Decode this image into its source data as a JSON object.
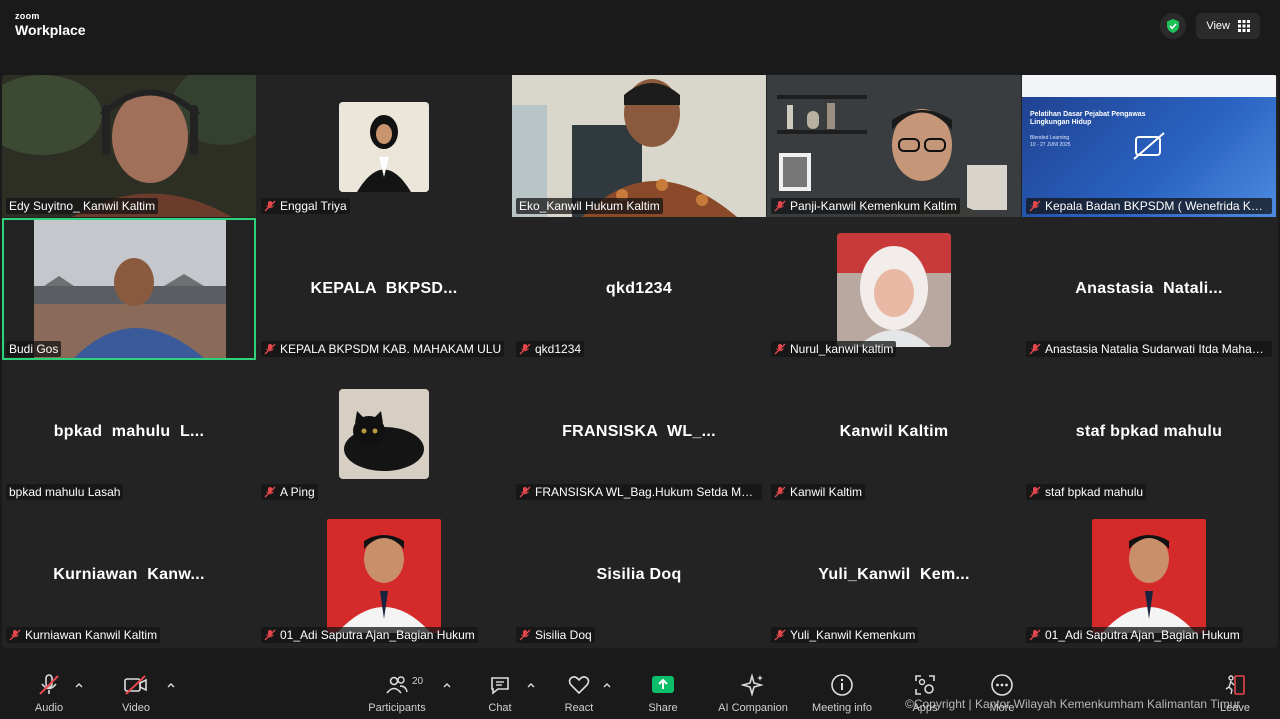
{
  "brand": {
    "small": "zoom",
    "big": "Workplace"
  },
  "topbar": {
    "view_label": "View",
    "shield_icon": "verified-shield-icon",
    "grid_icon": "grid-icon"
  },
  "tiles": [
    {
      "label": "Edy Suyitno_ Kanwil Kaltim",
      "muted": false,
      "kind": "video"
    },
    {
      "label": "Enggal Triya",
      "muted": true,
      "kind": "photo"
    },
    {
      "label": "Eko_Kanwil Hukum Kaltim",
      "muted": false,
      "kind": "video"
    },
    {
      "label": "Panji-Kanwil Kemenkum Kaltim",
      "muted": true,
      "kind": "video"
    },
    {
      "label": "Kepala Badan BKPSDM ( Wenefrida Kaya...",
      "muted": true,
      "kind": "slide",
      "slide_title": "Pelatihan Dasar Pejabat Pengawas Lingkungan Hidup",
      "slide_sub": "Blended Learning",
      "slide_date": "10 - 27 JUNI 2025"
    },
    {
      "label": "Budi Gos",
      "muted": false,
      "kind": "video",
      "active": true
    },
    {
      "label": "KEPALA BKPSDM KAB. MAHAKAM ULU",
      "muted": true,
      "kind": "name",
      "display": "KEPALA  BKPSD..."
    },
    {
      "label": "qkd1234",
      "muted": true,
      "kind": "name",
      "display": "qkd1234"
    },
    {
      "label": "Nurul_kanwil kaltim",
      "muted": true,
      "kind": "photo"
    },
    {
      "label": "Anastasia Natalia Sudarwati Itda Mahaka...",
      "muted": true,
      "kind": "name",
      "display": "Anastasia  Natali..."
    },
    {
      "label": "bpkad mahulu Lasah",
      "muted": false,
      "kind": "name",
      "display": "bpkad  mahulu  L..."
    },
    {
      "label": "A Ping",
      "muted": true,
      "kind": "photo"
    },
    {
      "label": "FRANSISKA WL_Bag.Hukum Setda Mahulu",
      "muted": true,
      "kind": "name",
      "display": "FRANSISKA  WL_..."
    },
    {
      "label": "Kanwil Kaltim",
      "muted": true,
      "kind": "name",
      "display": "Kanwil Kaltim"
    },
    {
      "label": "staf bpkad mahulu",
      "muted": true,
      "kind": "name",
      "display": "staf bpkad mahulu"
    },
    {
      "label": "Kurniawan Kanwil Kaltim",
      "muted": true,
      "kind": "name",
      "display": "Kurniawan  Kanw..."
    },
    {
      "label": "01_Adi Saputra Ajan_Bagian Hukum",
      "muted": true,
      "kind": "photo"
    },
    {
      "label": "Sisilia Doq",
      "muted": true,
      "kind": "name",
      "display": "Sisilia Doq"
    },
    {
      "label": "Yuli_Kanwil Kemenkum",
      "muted": true,
      "kind": "name",
      "display": "Yuli_Kanwil  Kem..."
    },
    {
      "label": "01_Adi Saputra Ajan_Bagian Hukum",
      "muted": true,
      "kind": "photo"
    }
  ],
  "toolbar": {
    "audio": "Audio",
    "video": "Video",
    "participants": "Participants",
    "participants_count": "20",
    "chat": "Chat",
    "react": "React",
    "share": "Share",
    "ai_companion": "AI Companion",
    "meeting_info": "Meeting info",
    "apps": "Apps",
    "more": "More",
    "leave": "Leave"
  },
  "colors": {
    "share_green": "#0bbf6a",
    "active_border": "#2fd17a",
    "mute_red": "#e5484d"
  },
  "overlay": {
    "copyright": "©Copyright | Kantor Wilayah Kemenkumham Kalimantan Timur"
  }
}
